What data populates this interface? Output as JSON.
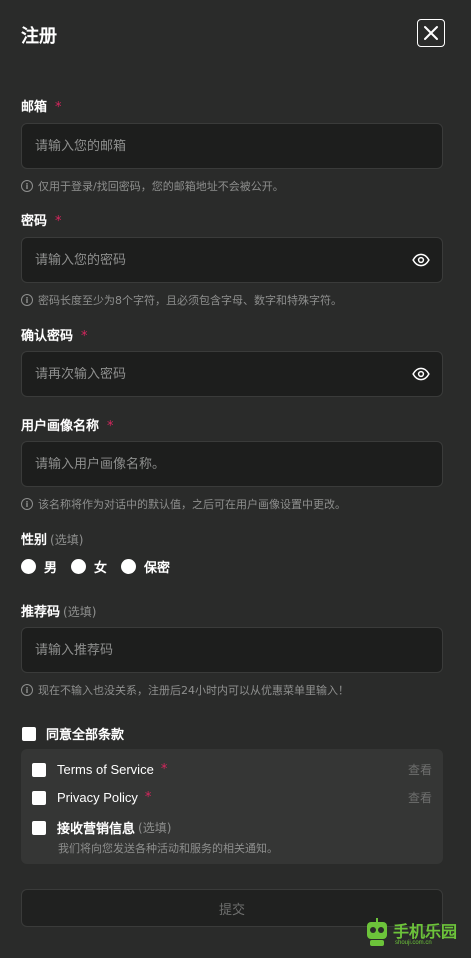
{
  "header": {
    "title": "注册"
  },
  "email": {
    "label": "邮箱",
    "required_mark": "*",
    "placeholder": "请输入您的邮箱",
    "hint": "仅用于登录/找回密码，您的邮箱地址不会被公开。"
  },
  "password": {
    "label": "密码",
    "required_mark": "*",
    "placeholder": "请输入您的密码",
    "hint": "密码长度至少为8个字符，且必须包含字母、数字和特殊字符。"
  },
  "confirm_password": {
    "label": "确认密码",
    "required_mark": "*",
    "placeholder": "请再次输入密码"
  },
  "persona_name": {
    "label": "用户画像名称",
    "required_mark": "*",
    "placeholder": "请输入用户画像名称。",
    "hint": "该名称将作为对话中的默认值，之后可在用户画像设置中更改。"
  },
  "gender": {
    "label": "性别",
    "optional": "(选填)",
    "options": [
      "男",
      "女",
      "保密"
    ]
  },
  "referral": {
    "label": "推荐码",
    "optional": "(选填)",
    "placeholder": "请输入推荐码",
    "hint": "现在不输入也没关系，注册后24小时内可以从优惠菜单里输入！"
  },
  "agreements": {
    "agree_all": "同意全部条款",
    "terms": {
      "label": "Terms of Service",
      "required_mark": "*",
      "view": "查看"
    },
    "privacy": {
      "label": "Privacy Policy",
      "required_mark": "*",
      "view": "查看"
    },
    "marketing": {
      "label": "接收营销信息",
      "optional": "(选填)",
      "sub": "我们将向您发送各种活动和服务的相关通知。"
    }
  },
  "submit": {
    "label": "提交"
  },
  "watermark": {
    "text": "手机乐园",
    "sub": "shouji.com.cn"
  },
  "icons": {
    "close": "close-icon",
    "eye": "eye-icon",
    "info": "info-icon"
  },
  "colors": {
    "background": "#2a2b2a",
    "input_bg": "#1d1e1d",
    "required": "#d7265e",
    "muted": "#8e8f8e"
  }
}
